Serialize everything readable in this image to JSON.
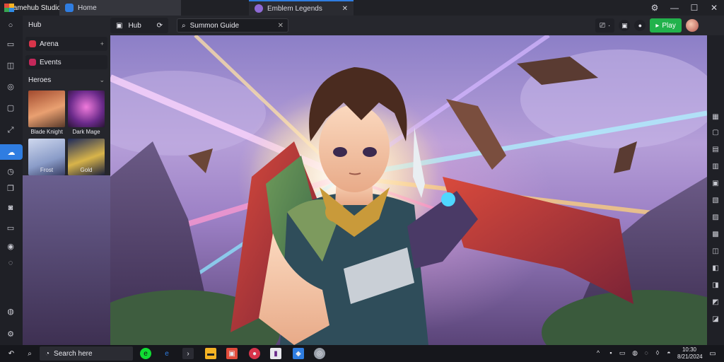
{
  "app": {
    "brand": "Gamehub Studio"
  },
  "tabs": [
    {
      "label": "Home",
      "close": ""
    },
    {
      "label": "Emblem Legends",
      "close": "✕"
    }
  ],
  "window_controls": {
    "minimize": "—",
    "maximize": "☐",
    "close": "✕",
    "settings": "⚙"
  },
  "toolbar": {
    "home_label": "Hub",
    "group_label": "Hub",
    "search_value": "Summon Guide",
    "search_clear": "✕",
    "play_label": "Play",
    "colors": {
      "play": "#22b24c",
      "accent": "#2f7de1"
    }
  },
  "sidebar": {
    "title": "Hub",
    "items": [
      {
        "label": "Arena",
        "chev": "+"
      },
      {
        "label": "Events",
        "chev": ""
      }
    ],
    "section_label": "Heroes",
    "section_chev": "⌄",
    "heroes": [
      {
        "label": "Blade Knight"
      },
      {
        "label": "Dark Mage"
      },
      {
        "label": "Frost"
      },
      {
        "label": "Gold"
      }
    ]
  },
  "taskbar": {
    "search_label": "Search here",
    "clock_time": "10:30",
    "clock_date": "8/21/2024"
  },
  "icons": {
    "left_rail": [
      "circle-icon",
      "image-icon",
      "cube-icon",
      "compass-icon",
      "folder-icon",
      "crop-icon",
      "cloud-icon",
      "clock-icon",
      "copy-icon",
      "camera-icon",
      "monitor-icon",
      "gamepad-icon",
      "help-icon",
      "user-icon"
    ],
    "right_rail": [
      "keyboard-icon",
      "gamepad-icon",
      "fullscreen-icon",
      "volume-icon",
      "rotate-icon",
      "screenshot-icon",
      "record-icon",
      "settings-icon",
      "more-icon",
      "back-icon",
      "home-icon"
    ]
  }
}
